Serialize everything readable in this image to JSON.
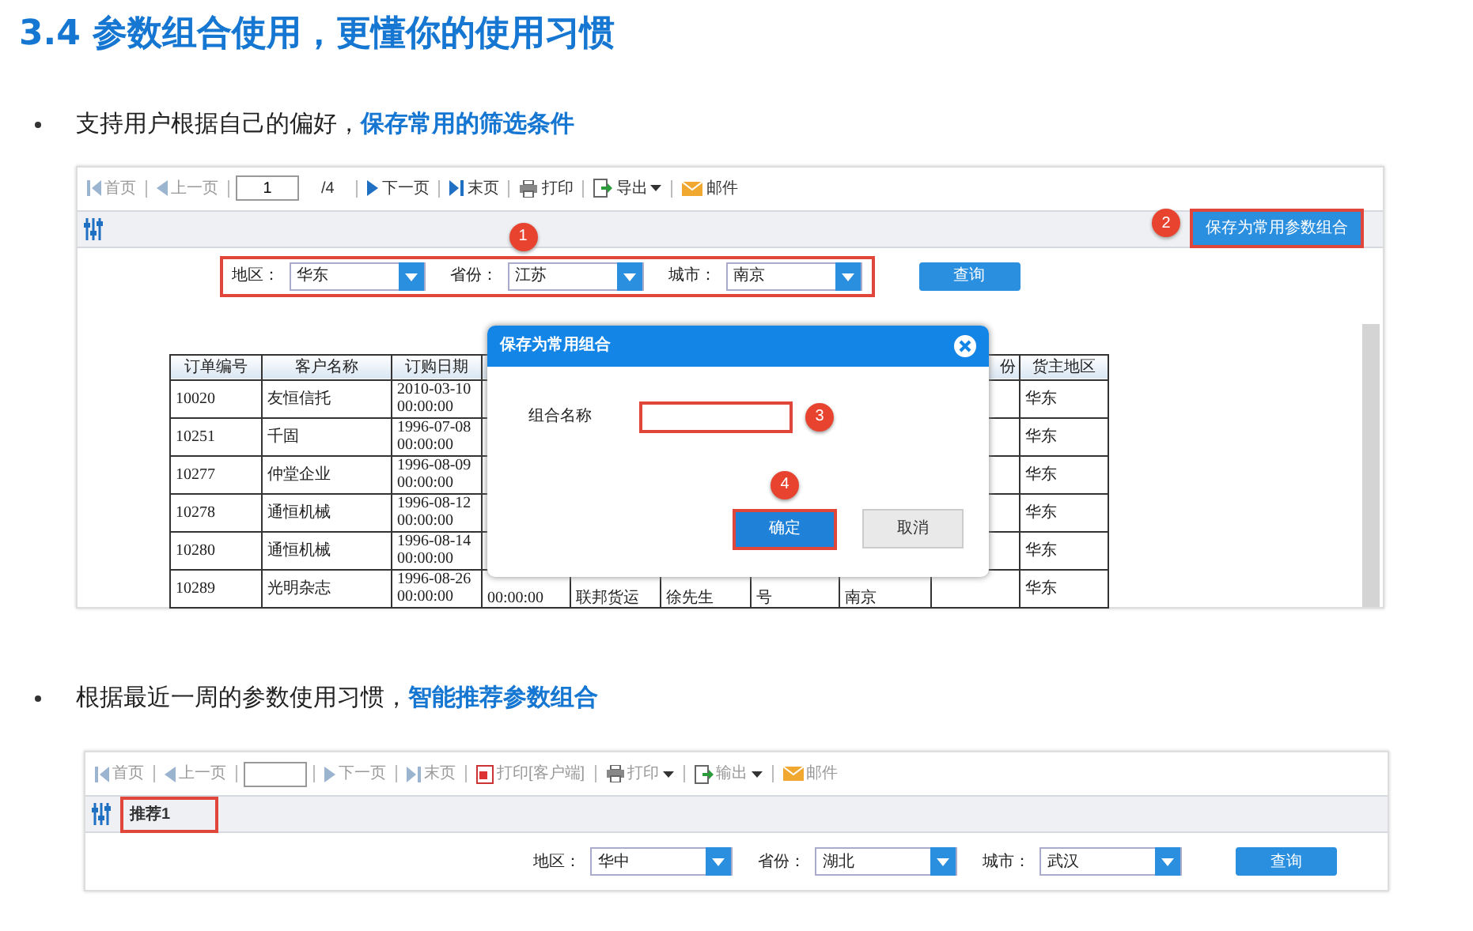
{
  "title": "3.4 参数组合使用，更懂你的使用习惯",
  "sections": [
    {
      "bullet": "支持用户根据自己的偏好，**保存常用的筛选条件**",
      "screenshot": {
        "toolbar": [
          {
            "kind": "first",
            "label": "首页",
            "disabled": true
          },
          {
            "kind": "prev",
            "label": "上一页",
            "disabled": true
          },
          {
            "kind": "page_input",
            "value": "1"
          },
          {
            "kind": "page_total",
            "label": "/4"
          },
          {
            "kind": "next",
            "label": "下一页",
            "disabled": false
          },
          {
            "kind": "last",
            "label": "末页",
            "disabled": false
          },
          {
            "kind": "print",
            "label": "打印",
            "disabled": false,
            "dropdown": false
          },
          {
            "kind": "export",
            "label": "导出",
            "disabled": false,
            "dropdown": true
          },
          {
            "kind": "mail",
            "label": "邮件",
            "disabled": false
          }
        ],
        "filter_bar": {
          "save_button": {
            "label": "保存为常用参数组合",
            "highlighted": true,
            "badge": "2"
          }
        },
        "params": {
          "highlighted": true,
          "badge": "1",
          "fields": [
            {
              "label": "地区：",
              "value": "华东"
            },
            {
              "label": "省份：",
              "value": "江苏"
            },
            {
              "label": "城市：",
              "value": "南京"
            }
          ],
          "query_button": "查询"
        },
        "table": {
          "columns": [
            "订单编号",
            "客户名称",
            "订购日期",
            null,
            null,
            null,
            null,
            null,
            "份",
            "货主地区"
          ],
          "rows": [
            [
              "10020",
              "友恒信托",
              "2010-03-10 00:00:00",
              null,
              null,
              null,
              null,
              null,
              null,
              "华东"
            ],
            [
              "10251",
              "千固",
              "1996-07-08 00:00:00",
              null,
              null,
              null,
              null,
              null,
              null,
              "华东"
            ],
            [
              "10277",
              "仲堂企业",
              "1996-08-09 00:00:00",
              null,
              null,
              null,
              null,
              null,
              null,
              "华东"
            ],
            [
              "10278",
              "通恒机械",
              "1996-08-12 00:00:00",
              null,
              null,
              null,
              null,
              null,
              null,
              "华东"
            ],
            [
              "10280",
              "通恒机械",
              "1996-08-14 00:00:00",
              null,
              null,
              null,
              null,
              null,
              null,
              "华东"
            ],
            [
              "10289",
              "光明杂志",
              "1996-08-26 00:00:00",
              "00:00:00",
              "联邦货运",
              "徐先生",
              "号",
              "南京",
              null,
              "华东"
            ]
          ]
        },
        "dialog": {
          "title": "保存为常用组合",
          "field_label": "组合名称",
          "field_badge": "3",
          "field_highlighted": true,
          "confirm": "确定",
          "confirm_badge": "4",
          "confirm_highlighted": true,
          "cancel": "取消"
        }
      }
    },
    {
      "bullet": "根据最近一周的参数使用习惯，**智能推荐参数组合**",
      "screenshot": {
        "toolbar": [
          {
            "kind": "first",
            "label": "首页",
            "disabled": true
          },
          {
            "kind": "prev",
            "label": "上一页",
            "disabled": true
          },
          {
            "kind": "page_input"
          },
          {
            "kind": "next",
            "label": "下一页",
            "disabled": true
          },
          {
            "kind": "last",
            "label": "末页",
            "disabled": true
          },
          {
            "kind": "client_print",
            "label": "打印[客户端]",
            "disabled": true
          },
          {
            "kind": "print",
            "label": "打印",
            "disabled": true,
            "dropdown": true
          },
          {
            "kind": "export",
            "label": "输出",
            "disabled": true,
            "dropdown": true
          },
          {
            "kind": "mail",
            "label": "邮件",
            "disabled": true
          }
        ],
        "filter_bar": {
          "saved_combo": {
            "label": "推荐1",
            "highlighted": true
          }
        },
        "params": {
          "highlighted": false,
          "fields": [
            {
              "label": "地区：",
              "value": "华中"
            },
            {
              "label": "省份：",
              "value": "湖北"
            },
            {
              "label": "城市：",
              "value": "武汉"
            }
          ],
          "query_button": "查询"
        }
      }
    }
  ]
}
